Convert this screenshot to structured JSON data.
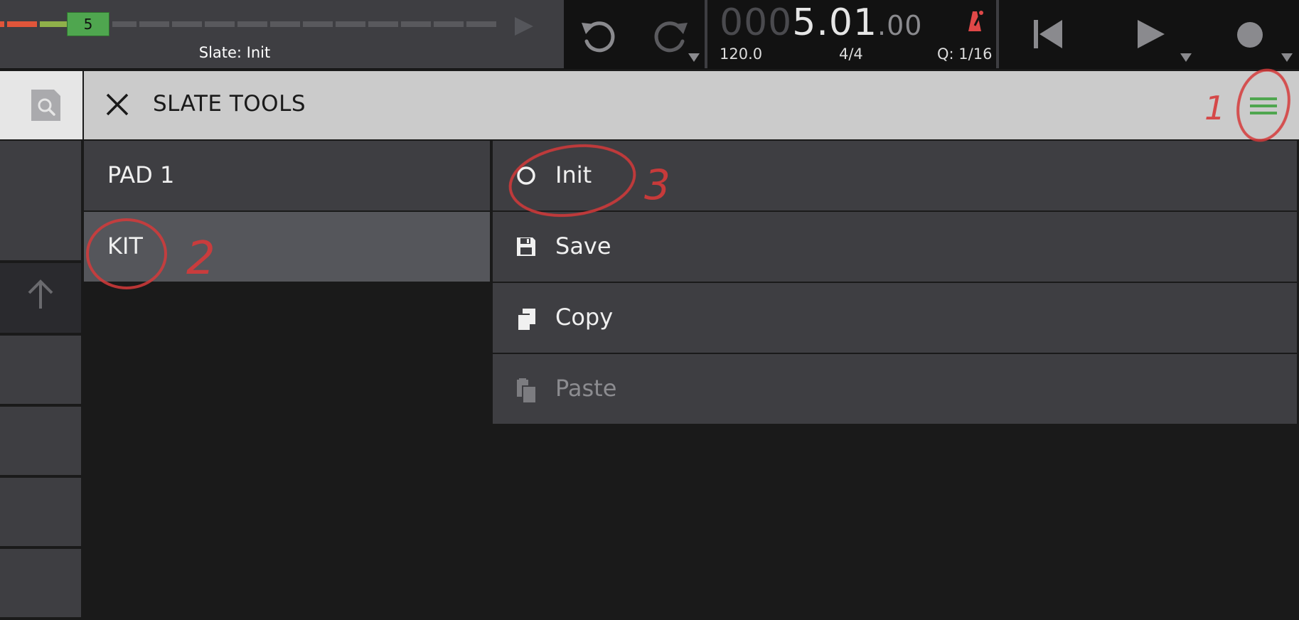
{
  "transport": {
    "pad_number": "5",
    "slate_label": "Slate: Init",
    "counter_dim": "000",
    "counter_lit": "5.01",
    "counter_small": ".00",
    "tempo": "120.0",
    "time_signature": "4/4",
    "quantize": "Q: 1/16"
  },
  "header": {
    "title": "SLATE TOOLS"
  },
  "targets": [
    {
      "label": "PAD 1",
      "selected": false
    },
    {
      "label": "KIT",
      "selected": true
    }
  ],
  "actions": [
    {
      "label": "Init",
      "icon": "circle-icon",
      "enabled": true
    },
    {
      "label": "Save",
      "icon": "floppy-disk-icon",
      "enabled": true
    },
    {
      "label": "Copy",
      "icon": "copy-icon",
      "enabled": true
    },
    {
      "label": "Paste",
      "icon": "paste-icon",
      "enabled": false
    }
  ],
  "annotations": {
    "mark_1": "1",
    "mark_2": "2",
    "mark_3": "3"
  },
  "colors": {
    "accent_green": "#4fa64f",
    "metronome_red": "#e04848",
    "annotation_red": "#d63a3a",
    "panel_gray": "#3e3e42",
    "header_gray": "#cbcbcb"
  }
}
